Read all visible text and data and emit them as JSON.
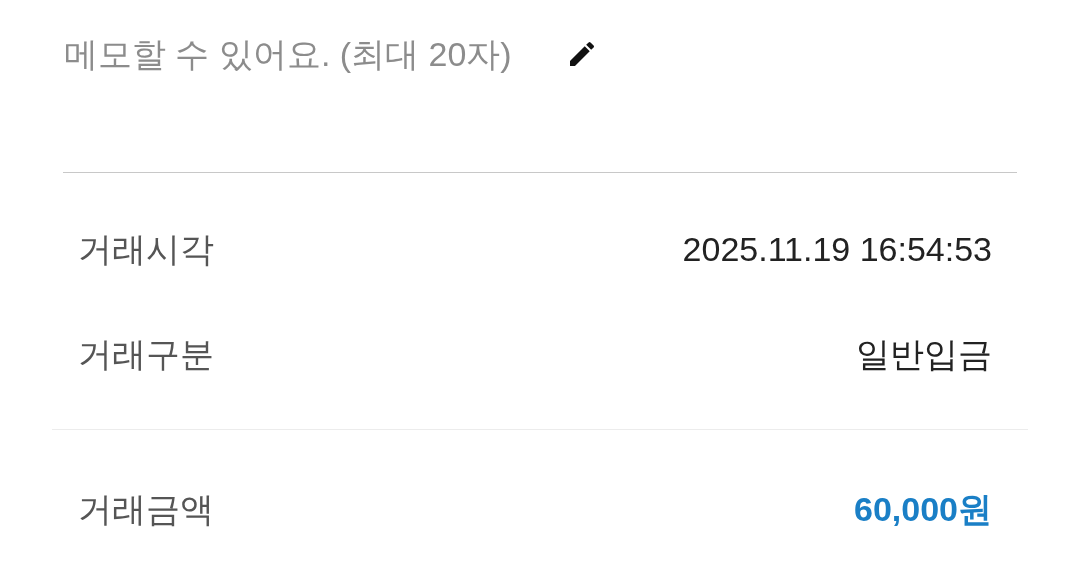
{
  "memo": {
    "placeholder": "메모할 수 있어요. (최대 20자)"
  },
  "details": [
    {
      "label": "거래시각",
      "value": "2025.11.19 16:54:53"
    },
    {
      "label": "거래구분",
      "value": "일반입금"
    }
  ],
  "amount": {
    "label": "거래금액",
    "value": "60,000원"
  }
}
